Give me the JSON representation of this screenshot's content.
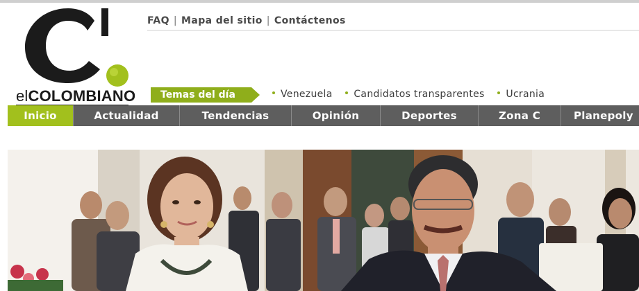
{
  "logo": {
    "prefix": "el",
    "name": "COLOMBIANO",
    "alt": "el COLOMBIANO"
  },
  "top_links": [
    {
      "label": "FAQ"
    },
    {
      "label": "Mapa del sitio"
    },
    {
      "label": "Contáctenos"
    }
  ],
  "separator": "|",
  "temas": {
    "label": "Temas del día",
    "items": [
      "Venezuela",
      "Candidatos transparentes",
      "Ucrania"
    ]
  },
  "nav": [
    {
      "label": "Inicio",
      "active": true
    },
    {
      "label": "Actualidad"
    },
    {
      "label": "Tendencias"
    },
    {
      "label": "Opinión"
    },
    {
      "label": "Deportes"
    },
    {
      "label": "Zona C"
    },
    {
      "label": "Planepoly"
    }
  ],
  "colors": {
    "brand_green": "#a2c01d",
    "temas_green": "#8fae1b",
    "nav_gray": "#5e5e5e",
    "logo_black": "#1b1b1b"
  }
}
